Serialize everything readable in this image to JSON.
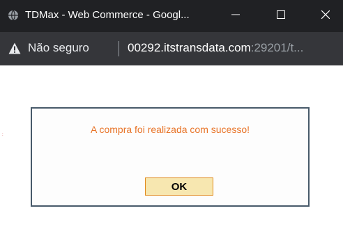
{
  "window": {
    "title": "TDMax - Web Commerce - Googl...",
    "favicon_icon": "globe-icon",
    "controls": {
      "minimize_icon": "minimize-icon",
      "maximize_icon": "maximize-icon",
      "close_icon": "close-icon"
    }
  },
  "address_bar": {
    "security_icon": "warning-icon",
    "security_label": "Não seguro",
    "url_host": "00292.itstransdata.com",
    "url_rest": ":29201/t..."
  },
  "dialog": {
    "message": "A compra foi realizada com sucesso!",
    "ok_label": "OK"
  },
  "colors": {
    "titlebar": "#202124",
    "addressbar": "#35363a",
    "message_text": "#e87428",
    "dialog_border": "#485a6a",
    "button_fill": "#f7e7b0",
    "button_border": "#e0891c"
  }
}
